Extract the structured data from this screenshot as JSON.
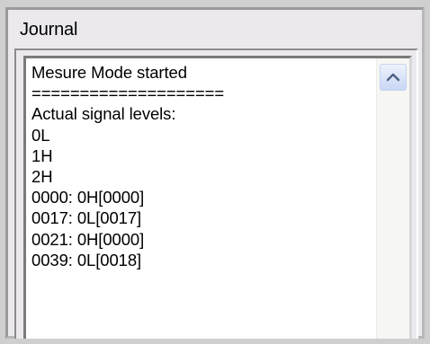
{
  "group": {
    "title": "Journal"
  },
  "journal": {
    "lines": [
      "Mesure Mode started",
      "====================",
      "Actual signal levels:",
      "0L",
      "1H",
      "2H",
      "0000: 0H[0000]",
      "0017: 0L[0017]",
      "0021: 0H[0000]",
      "0039: 0L[0018]"
    ]
  },
  "scrollbar": {
    "up_icon": "chevron-up-icon"
  }
}
